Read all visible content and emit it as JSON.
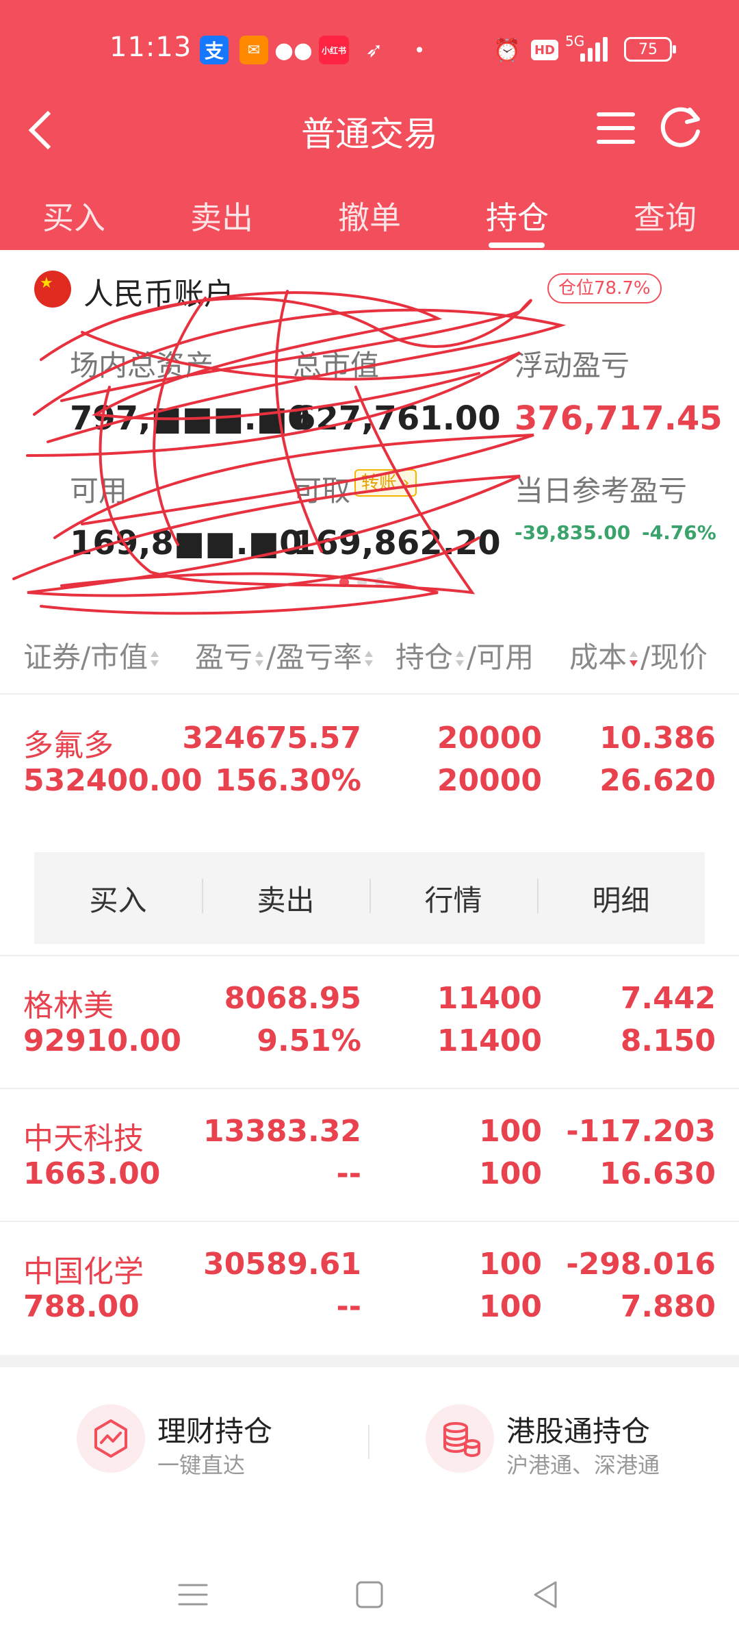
{
  "status_bar": {
    "time": "11:13",
    "network": "5G",
    "hd": "HD",
    "battery": "75",
    "icons": [
      "alipay-icon",
      "red-packet-icon",
      "wechat-icon",
      "xiaohongshu-icon",
      "feather-icon",
      "dot-icon",
      "alarm-icon"
    ],
    "xhs_label": "小红书",
    "alipay_label": "支"
  },
  "nav": {
    "title": "普通交易"
  },
  "tabs": [
    {
      "label": "买入"
    },
    {
      "label": "卖出"
    },
    {
      "label": "撤单"
    },
    {
      "label": "持仓",
      "active": true
    },
    {
      "label": "查询"
    }
  ],
  "account": {
    "title": "人民币账户",
    "position_ratio": "仓位78.7%",
    "total_assets_label": "场内总资产",
    "total_assets_value": "797,■■■.■0",
    "market_value_label": "总市值",
    "market_value_value": "627,761.00",
    "floating_pl_label": "浮动盈亏",
    "floating_pl_value": "376,717.45",
    "available_label": "可用",
    "available_value": "169,8■■.■0",
    "withdrawable_label": "可取",
    "transfer_label": "转账",
    "withdrawable_value": "169,862.20",
    "daily_pl_label": "当日参考盈亏",
    "daily_pl_value": "-39,835.00",
    "daily_pl_pct": "-4.76%"
  },
  "table": {
    "headers": {
      "col1": "证券/市值",
      "col2a": "盈亏",
      "col2b": "/盈亏率",
      "col3a": "持仓",
      "col3b": "/可用",
      "col4a": "成本",
      "col4b": "/现价"
    },
    "rows": [
      {
        "name": "多氟多",
        "market_value": "532400.00",
        "pl": "324675.57",
        "pl_rate": "156.30%",
        "holding": "20000",
        "available": "20000",
        "cost": "10.386",
        "price": "26.620"
      },
      {
        "name": "格林美",
        "market_value": "92910.00",
        "pl": "8068.95",
        "pl_rate": "9.51%",
        "holding": "11400",
        "available": "11400",
        "cost": "7.442",
        "price": "8.150"
      },
      {
        "name": "中天科技",
        "market_value": "1663.00",
        "pl": "13383.32",
        "pl_rate": "--",
        "holding": "100",
        "available": "100",
        "cost": "-117.203",
        "price": "16.630"
      },
      {
        "name": "中国化学",
        "market_value": "788.00",
        "pl": "30589.61",
        "pl_rate": "--",
        "holding": "100",
        "available": "100",
        "cost": "-298.016",
        "price": "7.880"
      }
    ],
    "row_actions": [
      "买入",
      "卖出",
      "行情",
      "明细"
    ]
  },
  "bottom_links": [
    {
      "title": "理财持仓",
      "subtitle": "一键直达"
    },
    {
      "title": "港股通持仓",
      "subtitle": "沪港通、深港通"
    }
  ],
  "colors": {
    "brand_red": "#f24e5b",
    "value_red": "#e8424e",
    "green": "#3aa36c"
  }
}
